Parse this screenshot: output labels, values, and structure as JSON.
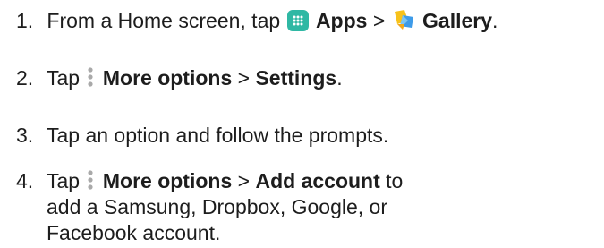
{
  "steps": [
    {
      "number": "1.",
      "text_before": "From a Home screen, tap",
      "apps_icon": "apps-grid-icon",
      "apps_label": "Apps",
      "separator": ">",
      "gallery_icon": "gallery-icon",
      "gallery_label": "Gallery",
      "end": "."
    },
    {
      "number": "2.",
      "text_before": "Tap",
      "more_icon": "more-options-icon",
      "more_label": "More options",
      "separator": ">",
      "settings_label": "Settings",
      "end": "."
    },
    {
      "number": "3.",
      "text": "Tap an option and follow the prompts."
    },
    {
      "number": "4.",
      "text_before": "Tap",
      "more_icon": "more-options-icon",
      "more_label": "More options",
      "separator": ">",
      "add_account_label": "Add account",
      "text_after": "to",
      "line2": "add a Samsung, Dropbox, Google, or",
      "line3": "Facebook account."
    }
  ],
  "colors": {
    "text": "#1d1d1d",
    "apps_icon_bg": "#2fb8a4",
    "gallery_yellow": "#f7c21b",
    "gallery_blue": "#3d9be9",
    "more_dots": "#a9a9a9"
  }
}
